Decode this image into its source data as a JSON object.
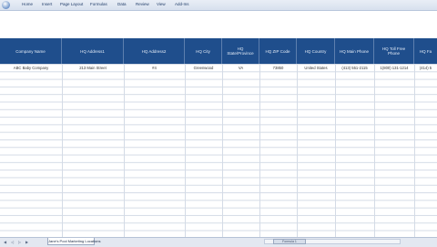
{
  "ribbon": {
    "tabs": [
      "Home",
      "Insert",
      "Page Layout",
      "Formulas",
      "Data",
      "Review",
      "View",
      "Add-Ins"
    ]
  },
  "table": {
    "headers": [
      "Company Name",
      "HQ Address1",
      "HQ Address2",
      "HQ City",
      "HQ State/Province",
      "HQ ZIP Code",
      "HQ Country",
      "HQ Main Phone",
      "HQ Toll Free Phone",
      "HQ Fa"
    ],
    "rows": [
      [
        "ABC Baby Company",
        "213 Main Street",
        "#4",
        "Greenwood",
        "VA",
        "73850",
        "United States",
        "(413) 551-2115",
        "1(800) 131-1214",
        "(414) 5"
      ]
    ]
  },
  "sheet": {
    "tab_label": "Jane's Pool Marketing Locations",
    "scroll_label": "Formula 1"
  }
}
